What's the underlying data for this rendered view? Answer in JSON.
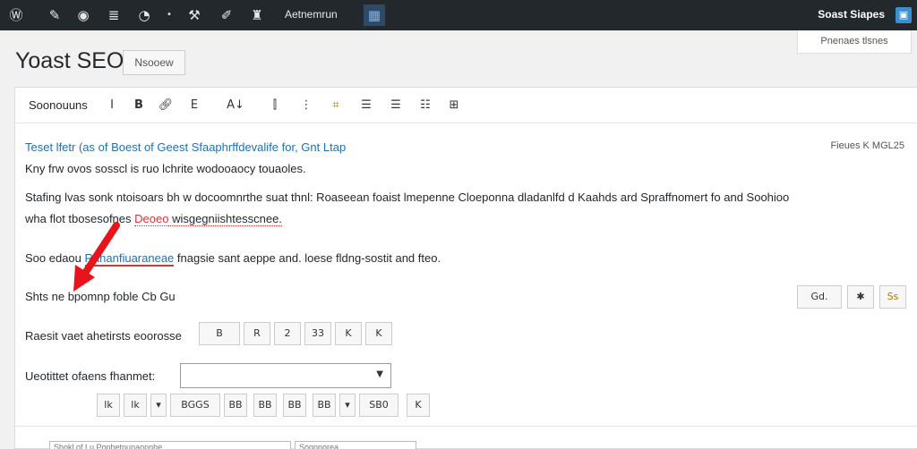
{
  "adminbar": {
    "active_label": "Aetnemrun",
    "user": "Soast Siapes",
    "icons": [
      "wordpress-icon",
      "dashboard-icon",
      "customize-icon",
      "menu-icon",
      "comments-icon",
      "plus-icon",
      "tools-icon",
      "edit-icon",
      "media-icon"
    ]
  },
  "screen_options": "Pnenaes tlsnes",
  "page": {
    "title": "Yoast SEO",
    "add_new": "Nsooew"
  },
  "toolbar": {
    "format": "Soonouuns",
    "buttons": [
      "I",
      "B",
      "link",
      "E",
      "A",
      "alpha",
      "list",
      "hash",
      "align-left",
      "align-center",
      "align-right",
      "table"
    ],
    "labels": {
      "italic": "I",
      "bold": "B",
      "e": "E",
      "a": "A↓"
    }
  },
  "content": {
    "line1": "Teset lfetr (as of Boest of Geest Sfaaphrffdevalife for, Gnt Ltap",
    "line1_meta": "Fieues K MGL25",
    "line2": "Kny frw ovos sosscl is ruo lchrite wodooaocy touaoles.",
    "line3": "Stafing lvas sonk ntoisoars bh w docoomnrthe suat thnl: Roaseean foaist lmepenne Cloeponna dladanlfd d Kaahds ard Spraffnomert fo and Soohioo",
    "line4_a": "wha flot tbosesofnes ",
    "line4_red": "Deoeo",
    "line4_b": " wisgegniishtesscnee.",
    "line5_a": "Soo edaou",
    "line5_link": "Rahanfiuaraneae",
    "line5_b": " fnagsie sant aeppe and. loese fldng-sostit and fteo.",
    "line6": "Shts ne bpomnp foble Cb Gu",
    "line6_btns": [
      "Gd.",
      "✱",
      "Ss"
    ],
    "line7": "Raesit vaet ahetirsts eoorosse",
    "line7_btns": [
      "B",
      "R",
      "2",
      "33",
      "K",
      "K"
    ],
    "line8": "Ueotittet ofaens fhanmet:",
    "line9_btns": [
      "lk",
      "lk",
      "BGGS",
      "BB",
      "BB",
      "BB",
      "BB",
      "SB0",
      "K"
    ]
  },
  "bottom_fields": [
    "Shokl of Lu Ponhetnunaonnhe",
    "Soqonorea"
  ]
}
